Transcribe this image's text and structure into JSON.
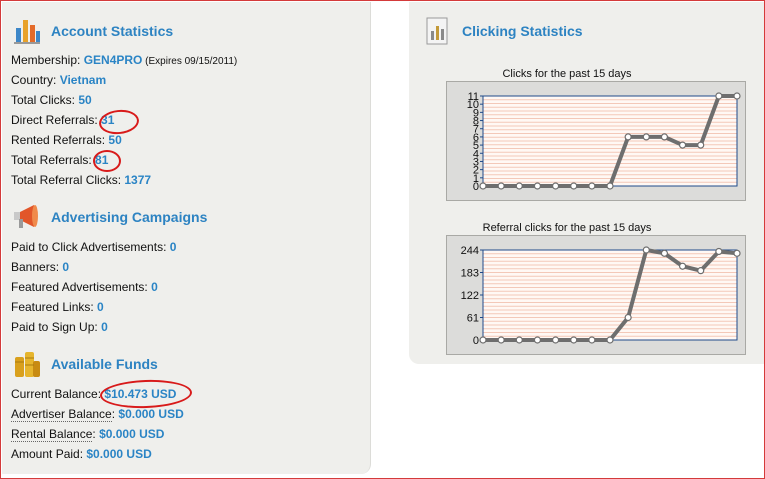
{
  "account": {
    "title": "Account Statistics",
    "icon": "bar-chart-icon",
    "membership_label": "Membership: ",
    "membership_value": "GEN4PRO",
    "membership_expires": " (Expires 09/15/2011)",
    "country_label": "Country: ",
    "country_value": "Vietnam",
    "total_clicks_label": "Total Clicks: ",
    "total_clicks_value": "50",
    "direct_referrals_label": "Direct Referrals: ",
    "direct_referrals_value": "31",
    "rented_referrals_label": "Rented Referrals: ",
    "rented_referrals_value": "50",
    "total_referrals_label": "Total Referrals: ",
    "total_referrals_value": "81",
    "total_referral_clicks_label": "Total Referral Clicks: ",
    "total_referral_clicks_value": "1377"
  },
  "advertising": {
    "title": "Advertising Campaigns",
    "icon": "megaphone-icon",
    "ptc_label": "Paid to Click Advertisements: ",
    "ptc_value": "0",
    "banners_label": "Banners: ",
    "banners_value": "0",
    "featured_ads_label": "Featured Advertisements: ",
    "featured_ads_value": "0",
    "featured_links_label": "Featured Links: ",
    "featured_links_value": "0",
    "paid_signup_label": "Paid to Sign Up: ",
    "paid_signup_value": "0"
  },
  "funds": {
    "title": "Available Funds",
    "icon": "coins-icon",
    "current_label": "Current Balance: ",
    "current_value": "$10.473 USD",
    "advertiser_label": "Advertiser Balance",
    "advertiser_value": "$0.000 USD",
    "rental_label": "Rental Balance",
    "rental_value": "$0.000 USD",
    "amount_paid_label": "Amount Paid: ",
    "amount_paid_value": "$0.000 USD"
  },
  "clicking": {
    "title": "Clicking Statistics",
    "icon": "chart-document-icon"
  },
  "chart_data": [
    {
      "type": "line",
      "title": "Clicks for the past 15 days",
      "y_ticks": [
        0,
        1,
        2,
        3,
        4,
        5,
        6,
        7,
        8,
        9,
        10,
        11
      ],
      "ylim": [
        0,
        11
      ],
      "values": [
        0,
        0,
        0,
        0,
        0,
        0,
        0,
        0,
        6,
        6,
        6,
        5,
        5,
        11,
        11
      ],
      "grid": true,
      "colors": {
        "line": "#6e6e6e",
        "grid": "#f3c8b8",
        "background": "#fff8f4",
        "axis": "#1f4a8a"
      }
    },
    {
      "type": "line",
      "title": "Referral clicks for the past 15 days",
      "y_ticks": [
        0,
        61,
        122,
        183,
        244
      ],
      "ylim": [
        0,
        244
      ],
      "values": [
        0,
        0,
        0,
        0,
        0,
        0,
        0,
        0,
        61,
        244,
        235,
        200,
        188,
        240,
        235
      ],
      "grid": true,
      "colors": {
        "line": "#6e6e6e",
        "grid": "#f3c8b8",
        "background": "#fff8f4",
        "axis": "#1f4a8a"
      }
    }
  ]
}
